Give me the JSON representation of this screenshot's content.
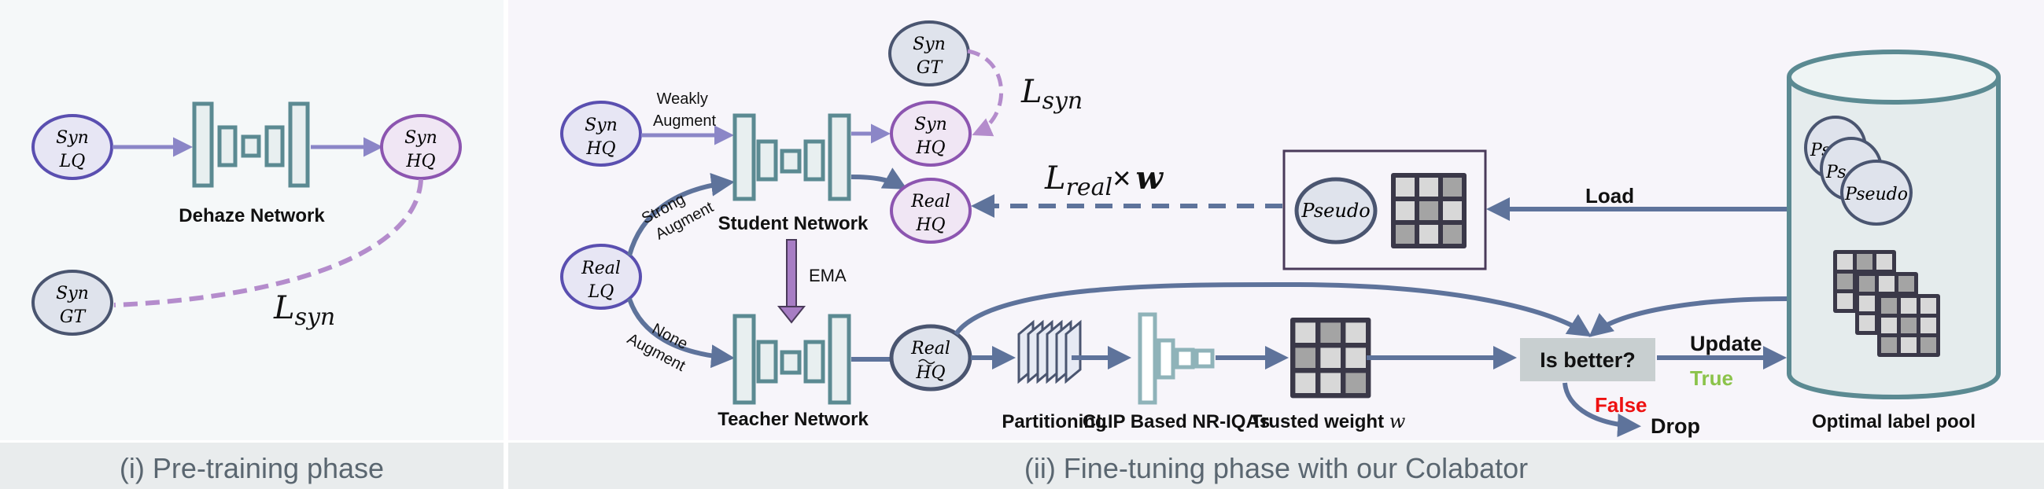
{
  "colors": {
    "panel1_bg": "#f5f8f9",
    "panel2_bg": "#f7f5fa",
    "caption_bg": "#e9eced",
    "caption_text": "#5a6670",
    "network_stroke": "#5b8a92",
    "network_fill": "#e8eff0",
    "clip_stroke": "#8fb3b9",
    "arrow_purple": "#8b86c7",
    "arrow_slate": "#5e739b",
    "loss_dash": "#b48ccc",
    "ema_arrow": "#a77dc4",
    "lq_stroke": "#5a4fb0",
    "lq_fill": "#e7e6f4",
    "hq_stroke": "#8c55b0",
    "hq_fill": "#f0e6f4",
    "gt_stroke": "#4a5570",
    "gt_fill": "#dfe3ec",
    "grid_dark": "#3a3848",
    "grid_light": "#d8d8d8",
    "grid_mid": "#a4a4a4",
    "decision_fill": "#c8cfd0",
    "true_color": "#8bc34a",
    "false_color": "#ee1111",
    "pool_stroke": "#5b8a92",
    "pool_fill": "#e5eced"
  },
  "panel_pretraining": {
    "caption": "(i) Pre-training phase",
    "nodes": {
      "syn_lq": [
        "Syn",
        "LQ"
      ],
      "syn_hq": [
        "Syn",
        "HQ"
      ],
      "syn_gt": [
        "Syn",
        "GT"
      ]
    },
    "network_label": "Dehaze Network",
    "loss": {
      "main": "L",
      "sub": "syn"
    }
  },
  "panel_finetuning": {
    "caption": "(ii) Fine-tuning phase with our Colabator",
    "nodes": {
      "syn_hq_in": [
        "Syn",
        "HQ"
      ],
      "real_lq": [
        "Real",
        "LQ"
      ],
      "syn_gt": [
        "Syn",
        "GT"
      ],
      "syn_hq_out": [
        "Syn",
        "HQ"
      ],
      "real_hq_out": [
        "Real",
        "HQ"
      ],
      "real_hq_tilde": [
        "Real",
        "HQ"
      ],
      "pseudo": "Pseudo",
      "pool_pseudo_partial": "Ps",
      "pool_pseudo": "Pseudo"
    },
    "edge_labels": {
      "weakly_augment": [
        "Weakly",
        "Augment"
      ],
      "strong_augment": [
        "Strong",
        "Augment"
      ],
      "none_augment": [
        "None",
        "Augment"
      ],
      "ema": "EMA",
      "load": "Load",
      "update": "Update",
      "true": "True",
      "false": "False",
      "drop": "Drop"
    },
    "component_labels": {
      "student": "Student Network",
      "teacher": "Teacher Network",
      "partitioning": "Partitioning",
      "clip": "CLIP Based NR-IQAs",
      "trusted_weight": "Trusted weight ",
      "trusted_weight_symbol": "w",
      "pool": "Optimal label pool",
      "decision": "Is better?"
    },
    "loss_syn": {
      "main": "L",
      "sub": "syn"
    },
    "loss_real": {
      "main": "L",
      "sub": "real",
      "times": "×",
      "weight": "w"
    },
    "weight_grid_pattern": {
      "pseudo_box": [
        "light",
        "light",
        "mid",
        "light",
        "mid",
        "light",
        "mid",
        "light",
        "mid"
      ],
      "trusted": [
        "light",
        "mid",
        "light",
        "mid",
        "light",
        "light",
        "light",
        "light",
        "mid"
      ],
      "pool_back": [
        "light",
        "mid",
        "light",
        "mid",
        "mid",
        "light",
        "light",
        "light",
        "light"
      ],
      "pool_middle": [
        "mid",
        "light",
        "mid",
        "light",
        "light",
        "light",
        "light",
        "light",
        "light"
      ],
      "pool_front": [
        "mid",
        "light",
        "light",
        "light",
        "mid",
        "light",
        "mid",
        "light",
        "mid"
      ]
    }
  }
}
